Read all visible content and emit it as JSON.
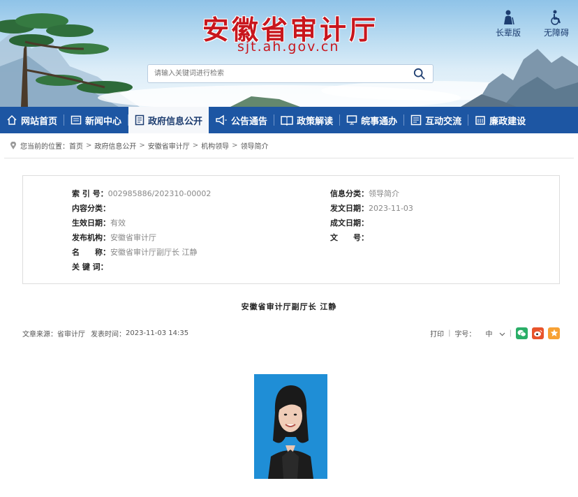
{
  "header": {
    "title": "安徽省审计厅",
    "domain": "sjt.ah.gov.cn",
    "search_placeholder": "请输入关键词进行检索",
    "elder_label": "长辈版",
    "accessible_label": "无障碍"
  },
  "nav": {
    "items": [
      {
        "label": "网站首页",
        "icon": "home-icon"
      },
      {
        "label": "新闻中心",
        "icon": "news-icon"
      },
      {
        "label": "政府信息公开",
        "icon": "document-icon"
      },
      {
        "label": "公告通告",
        "icon": "megaphone-icon"
      },
      {
        "label": "政策解读",
        "icon": "book-icon"
      },
      {
        "label": "皖事通办",
        "icon": "monitor-icon"
      },
      {
        "label": "互动交流",
        "icon": "chat-form-icon"
      },
      {
        "label": "廉政建设",
        "icon": "building-icon"
      }
    ],
    "active_index": 2,
    "colors": {
      "bar": "#1d56a3",
      "active_bg": "#f5f7fa"
    }
  },
  "breadcrumb": {
    "prefix": "您当前的位置：",
    "items": [
      "首页",
      "政府信息公开",
      "安徽省审计厅",
      "机构领导",
      "领导简介"
    ]
  },
  "info": {
    "left": [
      {
        "key": "索 引 号：",
        "value": "002985886/202310-00002"
      },
      {
        "key": "内容分类：",
        "value": ""
      },
      {
        "key": "生效日期：",
        "value": "有效"
      },
      {
        "key": "发布机构：",
        "value": "安徽省审计厅"
      },
      {
        "key": "名　　称：",
        "value": "安徽省审计厅副厅长 江静"
      },
      {
        "key": "关 键 词：",
        "value": ""
      }
    ],
    "right": [
      {
        "key": "信息分类：",
        "value": "领导简介"
      },
      {
        "key": "发文日期：",
        "value": "2023-11-03"
      },
      {
        "key": "成文日期：",
        "value": ""
      },
      {
        "key": "文　　号：",
        "value": ""
      }
    ]
  },
  "article": {
    "title": "安徽省审计厅副厅长  江静",
    "source_label": "文章来源：",
    "source": "省审计厅",
    "time_label": "发表时间：",
    "time": "2023-11-03 14:35",
    "print_label": "打印",
    "font_label": "字号：",
    "font_value": "中",
    "share": [
      {
        "name": "wechat-icon",
        "color": "#2aae67"
      },
      {
        "name": "weibo-icon",
        "color": "#e8542b"
      },
      {
        "name": "favorite-icon",
        "color": "#f7a133"
      }
    ]
  },
  "colors": {
    "brand_red": "#c8161d",
    "brand_blue": "#1d56a3",
    "photo_bg": "#1f8ed6"
  }
}
